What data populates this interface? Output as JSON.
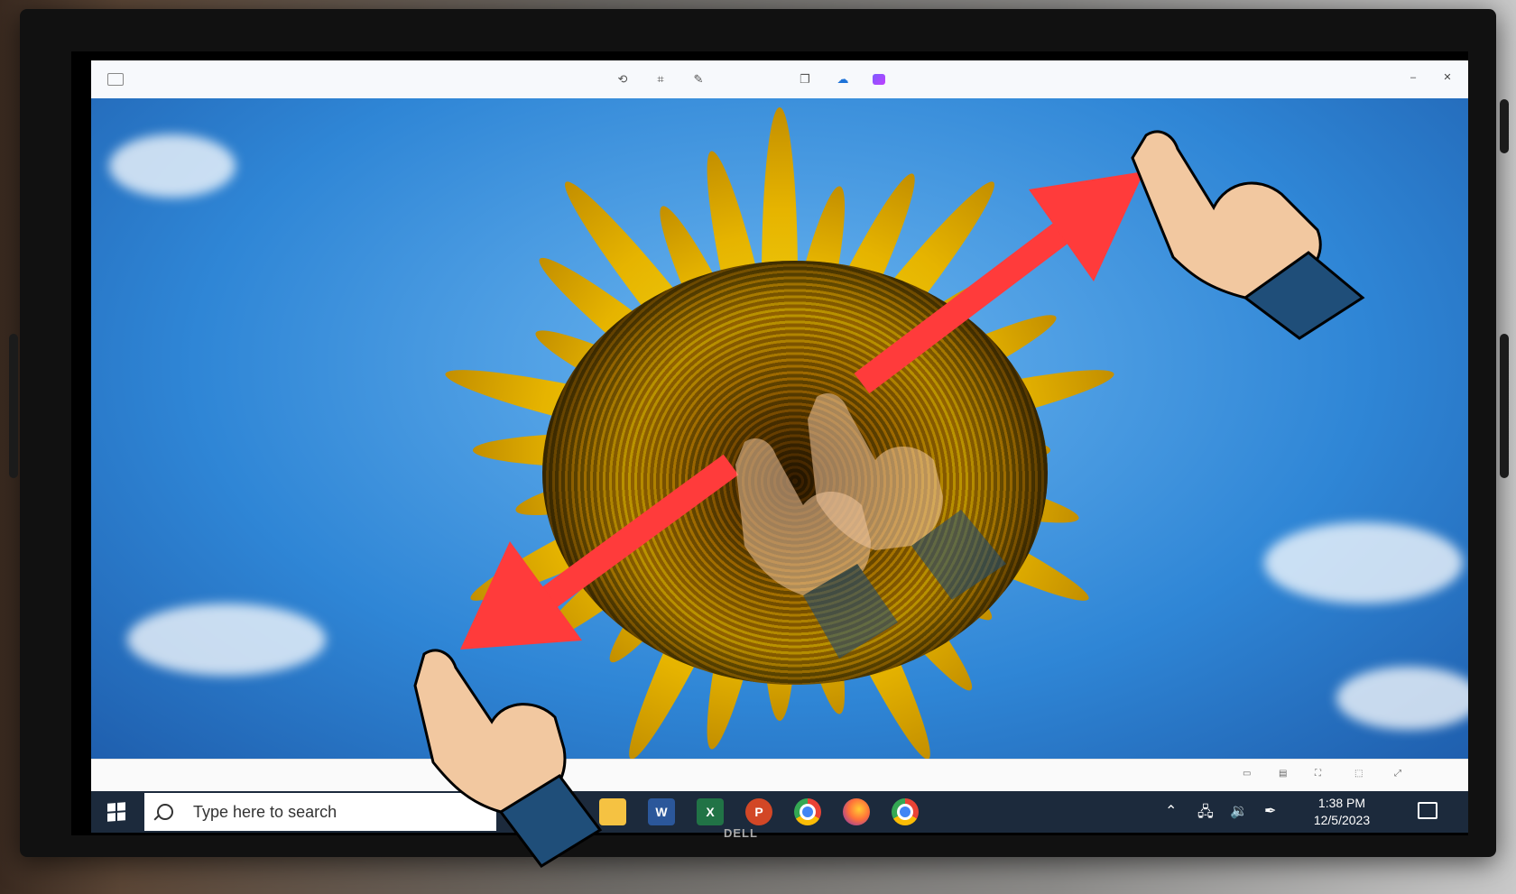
{
  "window": {
    "file_title": "",
    "toolbar_icons": [
      "rotate-icon",
      "crop-icon",
      "markup-icon",
      "duplicate-icon",
      "onedrive-icon",
      "clipchamp-icon"
    ],
    "controls": [
      "minimize",
      "close"
    ]
  },
  "statusbar": {
    "left_text": "",
    "zoom": "",
    "icons": [
      "slideshow-icon",
      "filmstrip-icon",
      "fit-icon",
      "fullscreen-icon",
      "expand-icon"
    ]
  },
  "taskbar": {
    "search_placeholder": "Type here to search",
    "pinned_apps": [
      {
        "name": "File Explorer",
        "glyph": ""
      },
      {
        "name": "Word",
        "glyph": "W",
        "color": "#2b579a"
      },
      {
        "name": "Excel",
        "glyph": "X",
        "color": "#217346"
      },
      {
        "name": "PowerPoint",
        "glyph": "P",
        "color": "#d24726"
      },
      {
        "name": "Chrome",
        "glyph": ""
      },
      {
        "name": "Firefox",
        "glyph": ""
      },
      {
        "name": "Chrome",
        "glyph": ""
      }
    ],
    "clock_time": "1:38 PM",
    "clock_date": "12/5/2023"
  },
  "monitor": {
    "brand": "DELL"
  },
  "overlay": {
    "gesture": "pinch-to-zoom",
    "arrow_color": "#ff3b3b",
    "hand_color": "#f2c8a0",
    "sleeve_color": "#1f4e79"
  }
}
